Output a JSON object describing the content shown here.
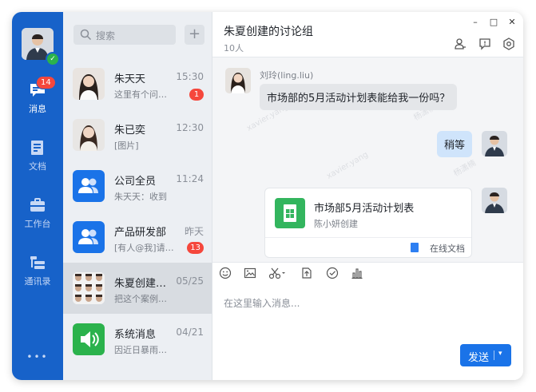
{
  "rail": {
    "badge": "14",
    "items": [
      {
        "label": "消息",
        "icon": "chat-bubble-icon"
      },
      {
        "label": "文档",
        "icon": "document-icon"
      },
      {
        "label": "工作台",
        "icon": "briefcase-icon"
      },
      {
        "label": "通讯录",
        "icon": "contacts-icon"
      }
    ],
    "more": "•••"
  },
  "search": {
    "placeholder": "搜索",
    "add": "+"
  },
  "conversations": [
    {
      "name": "朱天天",
      "time": "15:30",
      "preview": "这里有个问题需要你来处理",
      "badge": "1",
      "avatar": "woman-portrait"
    },
    {
      "name": "朱已奕",
      "time": "12:30",
      "preview": "[图片]",
      "badge": "",
      "avatar": "woman-portrait"
    },
    {
      "name": "公司全员",
      "time": "11:24",
      "preview": "朱天天：收到",
      "badge": "",
      "avatar": "group-icon"
    },
    {
      "name": "产品研发部",
      "time": "昨天",
      "preview": "[有人@我]请尽快处理",
      "badge": "13",
      "avatar": "group-icon"
    },
    {
      "name": "朱夏创建的讨论组",
      "time": "05/25",
      "preview": "把这个案例再整理一下",
      "badge": "",
      "avatar": "grid-avatars"
    },
    {
      "name": "系统消息",
      "time": "04/21",
      "preview": "因近日暴雨天气请注意",
      "badge": "",
      "avatar": "speaker-icon"
    }
  ],
  "chat": {
    "title": "朱夏创建的讨论组",
    "member_count": "10人",
    "window": {
      "minimize": "–",
      "maximize": "□",
      "close": "✕"
    },
    "watermark": "xavier.yang",
    "watermark_cn": "杨潇楠",
    "messages": {
      "sender": "刘玲(ling.liu)",
      "incoming": "市场部的5月活动计划表能给我一份吗？",
      "reply": "稍等",
      "card_title": "市场部5月活动计划表",
      "card_sub": "陈小妍创建",
      "card_foot": "在线文档"
    },
    "input_placeholder": "在这里输入消息...",
    "send_label": "发送",
    "send_caret": "▾"
  },
  "colors": {
    "rail": "#1762c9",
    "accent": "#1a73e8",
    "badge": "#f5473c",
    "sheet": "#33b55e"
  }
}
